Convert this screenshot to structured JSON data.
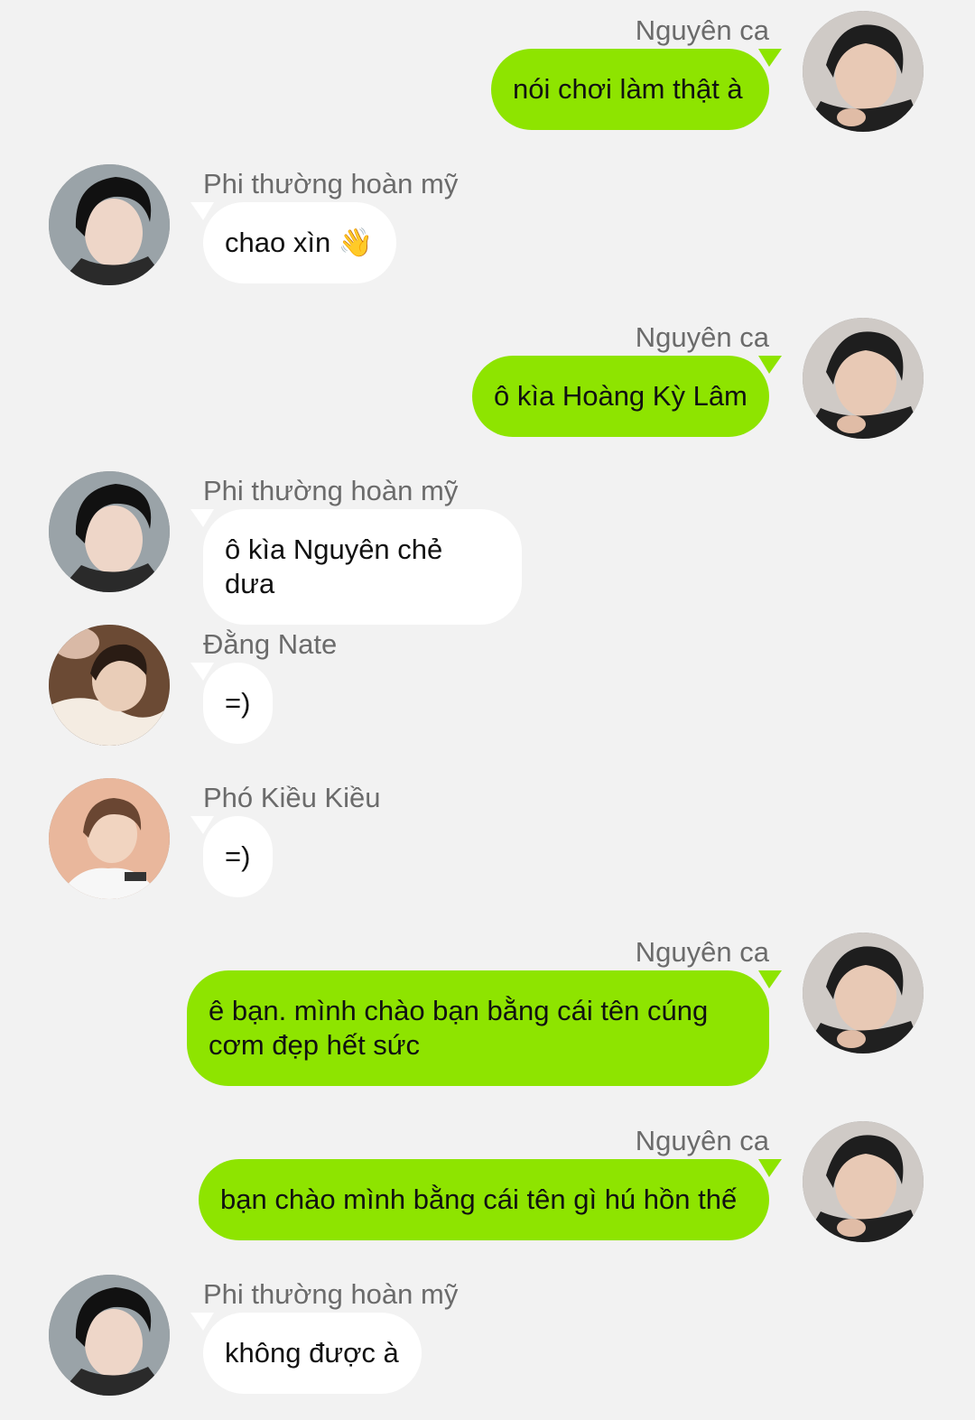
{
  "messages": [
    {
      "side": "right",
      "sender": "Nguyên ca",
      "text": "nói chơi làm thật à",
      "avatar": "avatar-nguyen"
    },
    {
      "side": "left",
      "sender": "Phi thường hoàn mỹ",
      "text": "chao xìn 👋",
      "avatar": "avatar-phi"
    },
    {
      "side": "right",
      "sender": "Nguyên ca",
      "text": "ô kìa Hoàng Kỳ Lâm",
      "avatar": "avatar-nguyen"
    },
    {
      "side": "left",
      "sender": "Phi thường hoàn mỹ",
      "text": "ô kìa Nguyên chẻ dưa",
      "avatar": "avatar-phi"
    },
    {
      "side": "left",
      "sender": "Đằng Nate",
      "text": "=)",
      "avatar": "avatar-dang"
    },
    {
      "side": "left",
      "sender": "Phó Kiều Kiều",
      "text": "=)",
      "avatar": "avatar-pho"
    },
    {
      "side": "right",
      "sender": "Nguyên ca",
      "text": "ê bạn. mình chào bạn bằng cái tên cúng\ncơm đẹp hết sức",
      "avatar": "avatar-nguyen"
    },
    {
      "side": "right",
      "sender": "Nguyên ca",
      "text": "bạn chào mình bằng cái tên gì hú hồn thế",
      "avatar": "avatar-nguyen"
    },
    {
      "side": "left",
      "sender": "Phi thường hoàn mỹ",
      "text": "không được à",
      "avatar": "avatar-phi"
    }
  ],
  "colors": {
    "background": "#f2f2f2",
    "outgoing_bubble": "#8ee400",
    "incoming_bubble": "#ffffff",
    "sender_name": "#6b6b6b"
  }
}
